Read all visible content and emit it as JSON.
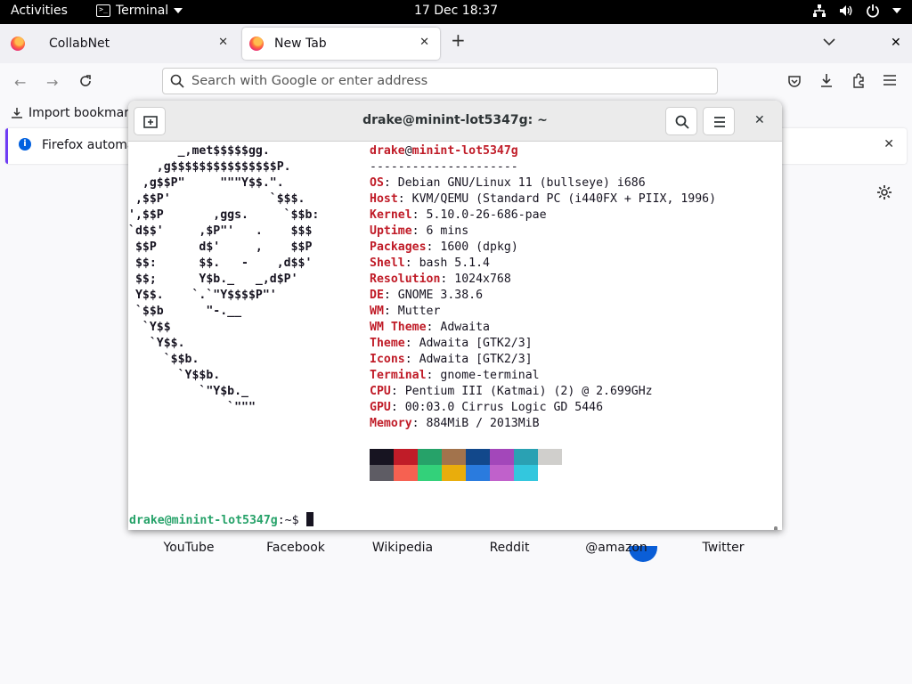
{
  "topbar": {
    "activities": "Activities",
    "app_name": "Terminal",
    "clock": "17 Dec  18:37"
  },
  "browser": {
    "tabs": [
      {
        "label": "CollabNet",
        "active": false
      },
      {
        "label": "New Tab",
        "active": true
      }
    ],
    "urlbar_placeholder": "Search with Google or enter address",
    "bookmarks_import": "Import bookmark",
    "notice_text": "Firefox automat",
    "shortcuts": [
      "YouTube",
      "Facebook",
      "Wikipedia",
      "Reddit",
      "@amazon",
      "Twitter"
    ]
  },
  "terminal": {
    "title": "drake@minint-lot5347g: ~",
    "logo_lines": [
      "       _,met$$$$$gg.",
      "    ,g$$$$$$$$$$$$$$$P.",
      "  ,g$$P\"     \"\"\"Y$$.\".",
      " ,$$P'              `$$$.",
      "',$$P       ,ggs.     `$$b:",
      "`d$$'     ,$P\"'   .    $$$",
      " $$P      d$'     ,    $$P",
      " $$:      $$.   -    ,d$$'",
      " $$;      Y$b._   _,d$P'",
      " Y$$.    `.`\"Y$$$$P\"'",
      " `$$b      \"-.__",
      "  `Y$$",
      "   `Y$$.",
      "     `$$b.",
      "       `Y$$b.",
      "          `\"Y$b._",
      "              `\"\"\""
    ],
    "user": "drake",
    "host": "minint-lot5347g",
    "separator": "---------------------",
    "info": [
      {
        "key": "OS",
        "value": "Debian GNU/Linux 11 (bullseye) i686"
      },
      {
        "key": "Host",
        "value": "KVM/QEMU (Standard PC (i440FX + PIIX, 1996)"
      },
      {
        "key": "Kernel",
        "value": "5.10.0-26-686-pae"
      },
      {
        "key": "Uptime",
        "value": "6 mins"
      },
      {
        "key": "Packages",
        "value": "1600 (dpkg)"
      },
      {
        "key": "Shell",
        "value": "bash 5.1.4"
      },
      {
        "key": "Resolution",
        "value": "1024x768"
      },
      {
        "key": "DE",
        "value": "GNOME 3.38.6"
      },
      {
        "key": "WM",
        "value": "Mutter"
      },
      {
        "key": "WM Theme",
        "value": "Adwaita"
      },
      {
        "key": "Theme",
        "value": "Adwaita [GTK2/3]"
      },
      {
        "key": "Icons",
        "value": "Adwaita [GTK2/3]"
      },
      {
        "key": "Terminal",
        "value": "gnome-terminal"
      },
      {
        "key": "CPU",
        "value": "Pentium III (Katmai) (2) @ 2.699GHz"
      },
      {
        "key": "GPU",
        "value": "00:03.0 Cirrus Logic GD 5446"
      },
      {
        "key": "Memory",
        "value": "884MiB / 2013MiB"
      }
    ],
    "palette_row1": [
      "#171421",
      "#c01c28",
      "#26a269",
      "#a2734c",
      "#12488b",
      "#a347ba",
      "#2aa1b3",
      "#d0cfcc"
    ],
    "palette_row2": [
      "#5e5c64",
      "#f66151",
      "#33d17a",
      "#e9ad0c",
      "#2a7bde",
      "#c061cb",
      "#33c7de"
    ],
    "prompt_user": "drake@minint-lot5347g",
    "prompt_suffix": ":~$ "
  }
}
